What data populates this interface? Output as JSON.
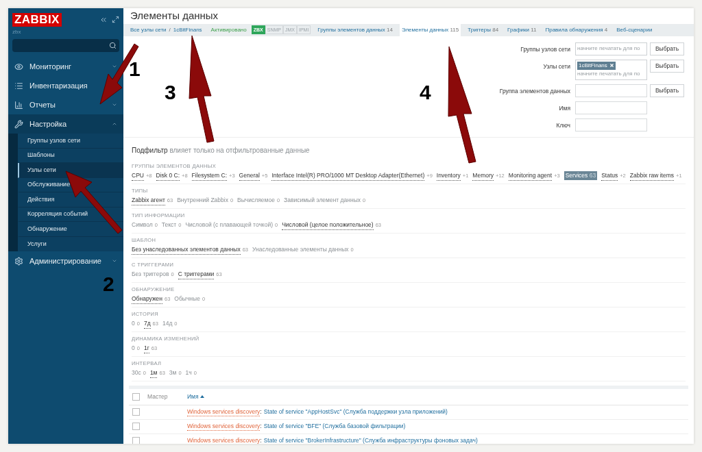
{
  "brand": {
    "logo": "ZABBIX",
    "server": "zbx"
  },
  "sidebar": {
    "items": [
      {
        "label": "Мониторинг",
        "expanded": false
      },
      {
        "label": "Инвентаризация",
        "expanded": false
      },
      {
        "label": "Отчеты",
        "expanded": false
      },
      {
        "label": "Настройка",
        "expanded": true,
        "children": [
          {
            "label": "Группы узлов сети",
            "selected": false
          },
          {
            "label": "Шаблоны",
            "selected": false
          },
          {
            "label": "Узлы сети",
            "selected": true
          },
          {
            "label": "Обслуживание",
            "selected": false
          },
          {
            "label": "Действия",
            "selected": false
          },
          {
            "label": "Корреляция событий",
            "selected": false
          },
          {
            "label": "Обнаружение",
            "selected": false
          },
          {
            "label": "Услуги",
            "selected": false
          }
        ]
      },
      {
        "label": "Администрирование",
        "expanded": false
      }
    ]
  },
  "page_title": "Элементы данных",
  "breadcrumbs": [
    "Все узлы сети",
    "1cBitFinans"
  ],
  "breadcrumb_separator": "/",
  "host_status": "Активировано",
  "availability": [
    {
      "label": "ZBX",
      "on": true
    },
    {
      "label": "SNMP",
      "on": false
    },
    {
      "label": "JMX",
      "on": false
    },
    {
      "label": "IPMI",
      "on": false
    }
  ],
  "tabs": [
    {
      "label": "Группы элементов данных",
      "count": "14",
      "selected": false
    },
    {
      "label": "Элементы данных",
      "count": "115",
      "selected": true
    },
    {
      "label": "Триггеры",
      "count": "84",
      "selected": false
    },
    {
      "label": "Графики",
      "count": "11",
      "selected": false
    },
    {
      "label": "Правила обнаружения",
      "count": "4",
      "selected": false
    },
    {
      "label": "Веб-сценарии",
      "selected": false
    }
  ],
  "filter": [
    {
      "label": "Группы узлов сети",
      "kind": "multiselect",
      "placeholder": "начните печатать для по",
      "button": "Выбрать"
    },
    {
      "label": "Узлы сети",
      "kind": "multiselect",
      "tags": [
        "1cBitFinans"
      ],
      "placeholder": "начните печатать для по",
      "button": "Выбрать"
    },
    {
      "label": "Группа элементов данных",
      "kind": "text",
      "button": "Выбрать"
    },
    {
      "label": "Имя",
      "kind": "text"
    },
    {
      "label": "Ключ",
      "kind": "text"
    }
  ],
  "subfilter": {
    "title": "Подфильтр",
    "note": "влияет только на отфильтрованные данные",
    "groups": [
      {
        "title": "ГРУППЫ ЭЛЕМЕНТОВ ДАННЫХ",
        "values": [
          {
            "label": "CPU",
            "count": "+8",
            "selected": false,
            "disabled": false
          },
          {
            "label": "Disk 0 C:",
            "count": "+8",
            "selected": false,
            "disabled": false
          },
          {
            "label": "Filesystem C:",
            "count": "+3",
            "selected": false,
            "disabled": false
          },
          {
            "label": "General",
            "count": "+5",
            "selected": false,
            "disabled": false
          },
          {
            "label": "Interface Intel(R) PRO/1000 MT Desktop Adapter(Ethernet)",
            "count": "+9",
            "selected": false,
            "disabled": false
          },
          {
            "label": "Inventory",
            "count": "+1",
            "selected": false,
            "disabled": false
          },
          {
            "label": "Memory",
            "count": "+12",
            "selected": false,
            "disabled": false
          },
          {
            "label": "Monitoring agent",
            "count": "+3",
            "selected": false,
            "disabled": false
          },
          {
            "label": "Services",
            "count": "63",
            "selected": true,
            "disabled": false
          },
          {
            "label": "Status",
            "count": "+2",
            "selected": false,
            "disabled": false
          },
          {
            "label": "Zabbix raw items",
            "count": "+1",
            "selected": false,
            "disabled": false
          }
        ]
      },
      {
        "title": "ТИПЫ",
        "values": [
          {
            "label": "Zabbix агент",
            "count": "63",
            "selected": false,
            "disabled": false
          },
          {
            "label": "Внутренний Zabbix",
            "count": "0",
            "selected": false,
            "disabled": true
          },
          {
            "label": "Вычисляемое",
            "count": "0",
            "selected": false,
            "disabled": true
          },
          {
            "label": "Зависимый элемент данных",
            "count": "0",
            "selected": false,
            "disabled": true
          }
        ]
      },
      {
        "title": "ТИП ИНФОРМАЦИИ",
        "values": [
          {
            "label": "Символ",
            "count": "0",
            "selected": false,
            "disabled": true
          },
          {
            "label": "Текст",
            "count": "0",
            "selected": false,
            "disabled": true
          },
          {
            "label": "Числовой (с плавающей точкой)",
            "count": "0",
            "selected": false,
            "disabled": true
          },
          {
            "label": "Числовой (целое положительное)",
            "count": "63",
            "selected": false,
            "disabled": false
          }
        ]
      },
      {
        "title": "ШАБЛОН",
        "values": [
          {
            "label": "Без унаследованных элементов данных",
            "count": "63",
            "selected": false,
            "disabled": false
          },
          {
            "label": "Унаследованные элементы данных",
            "count": "0",
            "selected": false,
            "disabled": true
          }
        ]
      },
      {
        "title": "С ТРИГГЕРАМИ",
        "values": [
          {
            "label": "Без триггеров",
            "count": "0",
            "selected": false,
            "disabled": true
          },
          {
            "label": "С триггерами",
            "count": "63",
            "selected": false,
            "disabled": false
          }
        ]
      },
      {
        "title": "ОБНАРУЖЕНИЕ",
        "values": [
          {
            "label": "Обнаружен",
            "count": "63",
            "selected": false,
            "disabled": false
          },
          {
            "label": "Обычные",
            "count": "0",
            "selected": false,
            "disabled": true
          }
        ]
      },
      {
        "title": "ИСТОРИЯ",
        "values": [
          {
            "label": "0",
            "count": "0",
            "selected": false,
            "disabled": true
          },
          {
            "label": "7д",
            "count": "63",
            "selected": false,
            "disabled": false
          },
          {
            "label": "14д",
            "count": "0",
            "selected": false,
            "disabled": true
          }
        ]
      },
      {
        "title": "ДИНАМИКА ИЗМЕНЕНИЙ",
        "values": [
          {
            "label": "0",
            "count": "0",
            "selected": false,
            "disabled": true
          },
          {
            "label": "1г",
            "count": "63",
            "selected": false,
            "disabled": false
          }
        ]
      },
      {
        "title": "ИНТЕРВАЛ",
        "values": [
          {
            "label": "30с",
            "count": "0",
            "selected": false,
            "disabled": true
          },
          {
            "label": "1м",
            "count": "63",
            "selected": false,
            "disabled": false
          },
          {
            "label": "3м",
            "count": "0",
            "selected": false,
            "disabled": true
          },
          {
            "label": "1ч",
            "count": "0",
            "selected": false,
            "disabled": true
          }
        ]
      }
    ]
  },
  "table": {
    "columns": [
      {
        "label": "Мастер",
        "sorted": false
      },
      {
        "label": "Имя",
        "sorted": true
      }
    ],
    "select_all": false,
    "rows": [
      {
        "checked": false,
        "rule": "Windows services discovery",
        "separator": ":",
        "name": "State of service \"AppHostSvc\" (Служба поддержки узла приложений)"
      },
      {
        "checked": false,
        "rule": "Windows services discovery",
        "separator": ":",
        "name": "State of service \"BFE\" (Служба базовой фильтрации)"
      },
      {
        "checked": false,
        "rule": "Windows services discovery",
        "separator": ":",
        "name": "State of service \"BrokerInfrastructure\" (Служба инфраструктуры фоновых задач)"
      }
    ]
  },
  "annotations": [
    "1",
    "2",
    "3",
    "4"
  ]
}
